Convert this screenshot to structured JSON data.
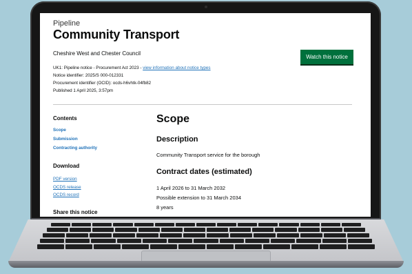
{
  "notice": {
    "caption": "Pipeline",
    "title": "Community Transport",
    "organisation": "Cheshire West and Chester Council",
    "watch_button": "Watch this notice",
    "type_line_prefix": "UK1: Pipeline notice - Procurement Act 2023 - ",
    "type_link": "view information about notice types",
    "notice_identifier": "Notice identifier: 2025/S 000-012331",
    "ocid": "Procurement identifier (OCID): ocds-h6vhtk-04fb82",
    "published": "Published 1 April 2025, 3:57pm"
  },
  "sidebar": {
    "contents_heading": "Contents",
    "contents_links": [
      "Scope",
      "Submission",
      "Contracting authority"
    ],
    "download_heading": "Download",
    "download_links": [
      "PDF version",
      "OCDS release",
      "OCDS record"
    ],
    "share_heading": "Share this notice"
  },
  "main": {
    "section_heading": "Scope",
    "description_heading": "Description",
    "description_text": "Community Transport service for the borough",
    "dates_heading": "Contract dates (estimated)",
    "dates_lines": [
      "1 April 2026 to 31 March 2032",
      "Possible extension to 31 March 2034",
      "8 years"
    ]
  },
  "colors": {
    "background": "#a7ccd9",
    "link": "#1d70b8",
    "button": "#00703c"
  }
}
